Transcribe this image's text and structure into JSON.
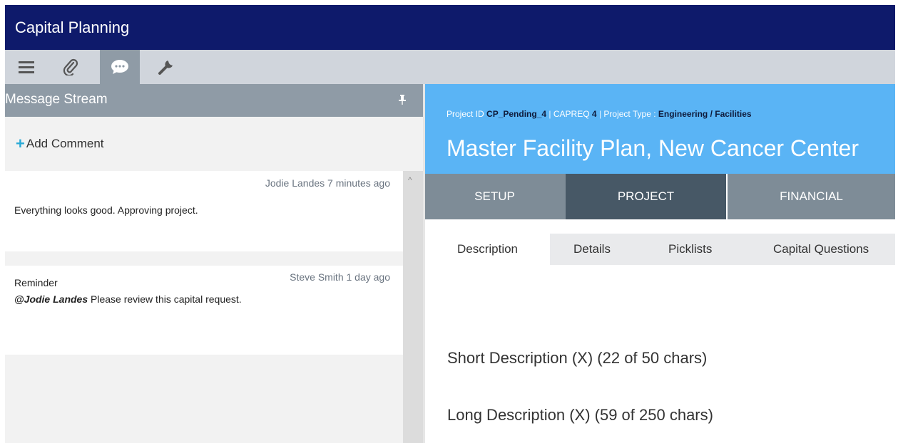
{
  "app": {
    "title": "Capital Planning"
  },
  "toolbar": {
    "items": [
      {
        "icon": "menu-icon"
      },
      {
        "icon": "paperclip-icon"
      },
      {
        "icon": "chat-bubble-icon",
        "active": true
      },
      {
        "icon": "wrench-icon"
      }
    ]
  },
  "message_stream": {
    "title": "Message Stream",
    "add_comment_label": "Add Comment",
    "messages": [
      {
        "author_time": "Jodie Landes 7 minutes ago",
        "subject": "",
        "mention": "",
        "text": "Everything looks good. Approving project."
      },
      {
        "author_time": "Steve Smith 1 day ago",
        "subject": "Reminder",
        "mention": "@Jodie Landes",
        "text": " Please review this capital request."
      }
    ]
  },
  "project": {
    "id_label": "Project ID",
    "id_value": "CP_Pending_4",
    "capreq_label": "CAPREQ",
    "capreq_value": "4",
    "type_label": "Project Type :",
    "type_value": "Engineering / Facilities",
    "separator": "|",
    "title": "Master Facility Plan, New Cancer Center"
  },
  "nav_tabs": [
    {
      "label": "SETUP",
      "active": false
    },
    {
      "label": "PROJECT",
      "active": true
    },
    {
      "label": "FINANCIAL",
      "active": false
    }
  ],
  "sub_tabs": [
    {
      "label": "Description",
      "active": true
    },
    {
      "label": "Details",
      "active": false
    },
    {
      "label": "Picklists",
      "active": false
    },
    {
      "label": "Capital Questions",
      "active": false
    }
  ],
  "fields": {
    "short_description": "Short Description (X) (22 of 50 chars)",
    "long_description": "Long Description (X) (59 of 250 chars)"
  },
  "colors": {
    "title_bar": "#0e1a6b",
    "toolbar": "#d0d5dc",
    "panel_header": "#8f9ba6",
    "project_header": "#5ab4f5",
    "nav_active": "#475866",
    "accent_plus": "#29a9d6"
  }
}
